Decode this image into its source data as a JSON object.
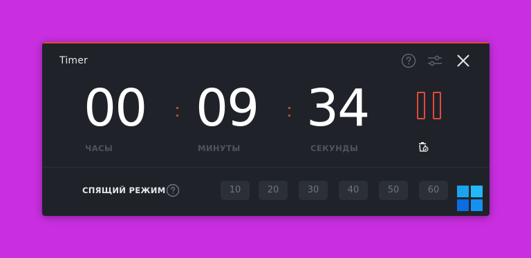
{
  "window": {
    "title": "Timer"
  },
  "timer": {
    "hours": "00",
    "minutes": "09",
    "seconds": "34",
    "hours_label": "ЧАСЫ",
    "minutes_label": "МИНУТЫ",
    "seconds_label": "СЕКУНДЫ",
    "state_icon": "pause-icon",
    "reset_icon": "trash-reset-icon"
  },
  "sleep_mode": {
    "label": "СПЯЩИЙ РЕЖИМ",
    "options": [
      "10",
      "20",
      "30",
      "40",
      "50",
      "60"
    ]
  },
  "colors": {
    "background": "#c92fe0",
    "window": "#1f2329",
    "accent": "#e8483b",
    "digit": "#ffffff",
    "muted_label": "#4e545c",
    "button_bg": "#2a3036",
    "button_text": "#6f7680"
  },
  "icons": {
    "help": "question-circle-icon",
    "settings": "sliders-icon",
    "close": "close-icon",
    "logo": "windows-logo-icon"
  }
}
